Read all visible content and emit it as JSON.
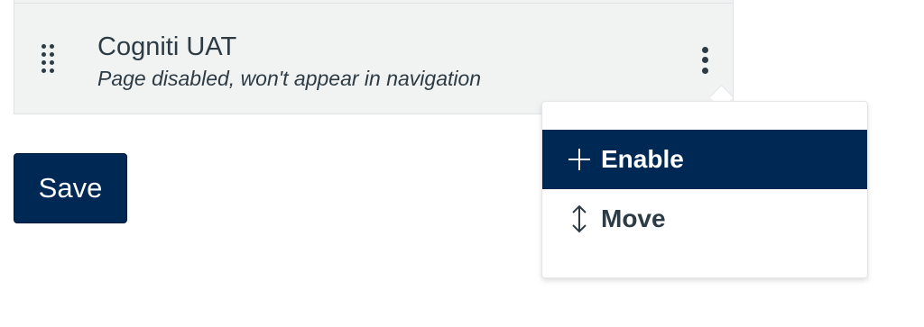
{
  "nav_item": {
    "title": "Cogniti UAT",
    "subtitle": "Page disabled, won't appear in navigation"
  },
  "save_button": {
    "label": "Save"
  },
  "menu": {
    "items": [
      {
        "label": "Enable",
        "icon": "plus-icon",
        "active": true
      },
      {
        "label": "Move",
        "icon": "vertical-arrows-icon",
        "active": false
      }
    ]
  },
  "colors": {
    "brand": "#002855",
    "row_bg": "#f1f2f2",
    "text": "#2d3b45"
  }
}
